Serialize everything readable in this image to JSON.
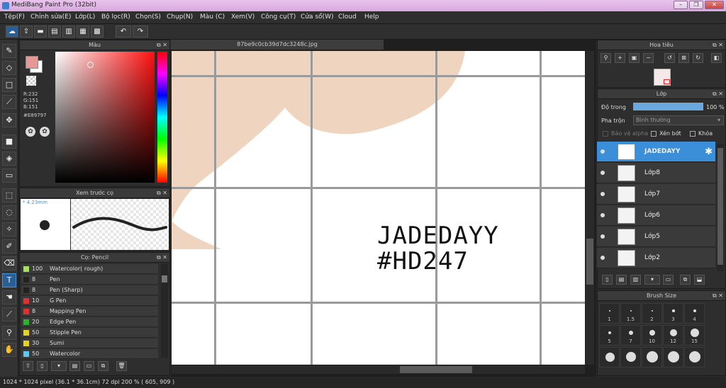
{
  "window": {
    "title": "MediBang Paint Pro (32bit)"
  },
  "menu": [
    "Tệp(F)",
    "Chỉnh sửa(E)",
    "Lớp(L)",
    "Bộ lọc(R)",
    "Chọn(S)",
    "Chụp(N)",
    "Màu (C)",
    "Xem(V)",
    "Công cụ(T)",
    "Cửa sổ(W)",
    "Cloud",
    "Help"
  ],
  "color_panel": {
    "title": "Màu",
    "r": "R:232",
    "g": "G:151",
    "b": "B:151",
    "hex": "#E89797",
    "fg_color": "#e89797",
    "bg_color": "#ffffff"
  },
  "preview_panel": {
    "title": "Xem trước cọ",
    "size": "* 4.23mm"
  },
  "brush_panel": {
    "title": "Cọ: Pencil",
    "items": [
      {
        "size": "100",
        "name": "Watercolor( rough)",
        "color": "#a8e060"
      },
      {
        "size": "8",
        "name": "Pen",
        "color": "#222222"
      },
      {
        "size": "8",
        "name": "Pen (Sharp)",
        "color": "#222222"
      },
      {
        "size": "10",
        "name": "G Pen",
        "color": "#e03030"
      },
      {
        "size": "8",
        "name": "Mapping Pen",
        "color": "#e03030"
      },
      {
        "size": "20",
        "name": "Edge Pen",
        "color": "#30b030"
      },
      {
        "size": "50",
        "name": "Stipple Pen",
        "color": "#e8d020"
      },
      {
        "size": "30",
        "name": "Sumi",
        "color": "#e8d020"
      },
      {
        "size": "50",
        "name": "Watercolor",
        "color": "#60c8f0"
      }
    ]
  },
  "document": {
    "tab": "87be9c0cb39d7dc3248c.jpg",
    "text_line1": "JADEDAYY",
    "text_line2": "#HD247"
  },
  "navigator_panel": {
    "title": "Hoa tiêu"
  },
  "layer_panel": {
    "title": "Lớp",
    "opacity_label": "Độ trong",
    "opacity_value": "100 %",
    "opacity": 1.0,
    "blend_label": "Pha trộn",
    "blend_value": "Bình thường",
    "protect_alpha": "Bảo vệ alpha",
    "clipping": "Xén bớt",
    "lock": "Khóa",
    "layers": [
      "JADEDAYY",
      "Lớp8",
      "Lớp7",
      "Lớp6",
      "Lớp5",
      "Lớp2"
    ]
  },
  "brush_size_panel": {
    "title": "Brush Size",
    "labels": [
      "1",
      "1.5",
      "2",
      "3",
      "4",
      "5",
      "7",
      "10",
      "12",
      "15"
    ]
  },
  "status": "1024 * 1024 pixel  (36.1 * 36.1cm)  72 dpi  200 %  ( 605, 909 )"
}
